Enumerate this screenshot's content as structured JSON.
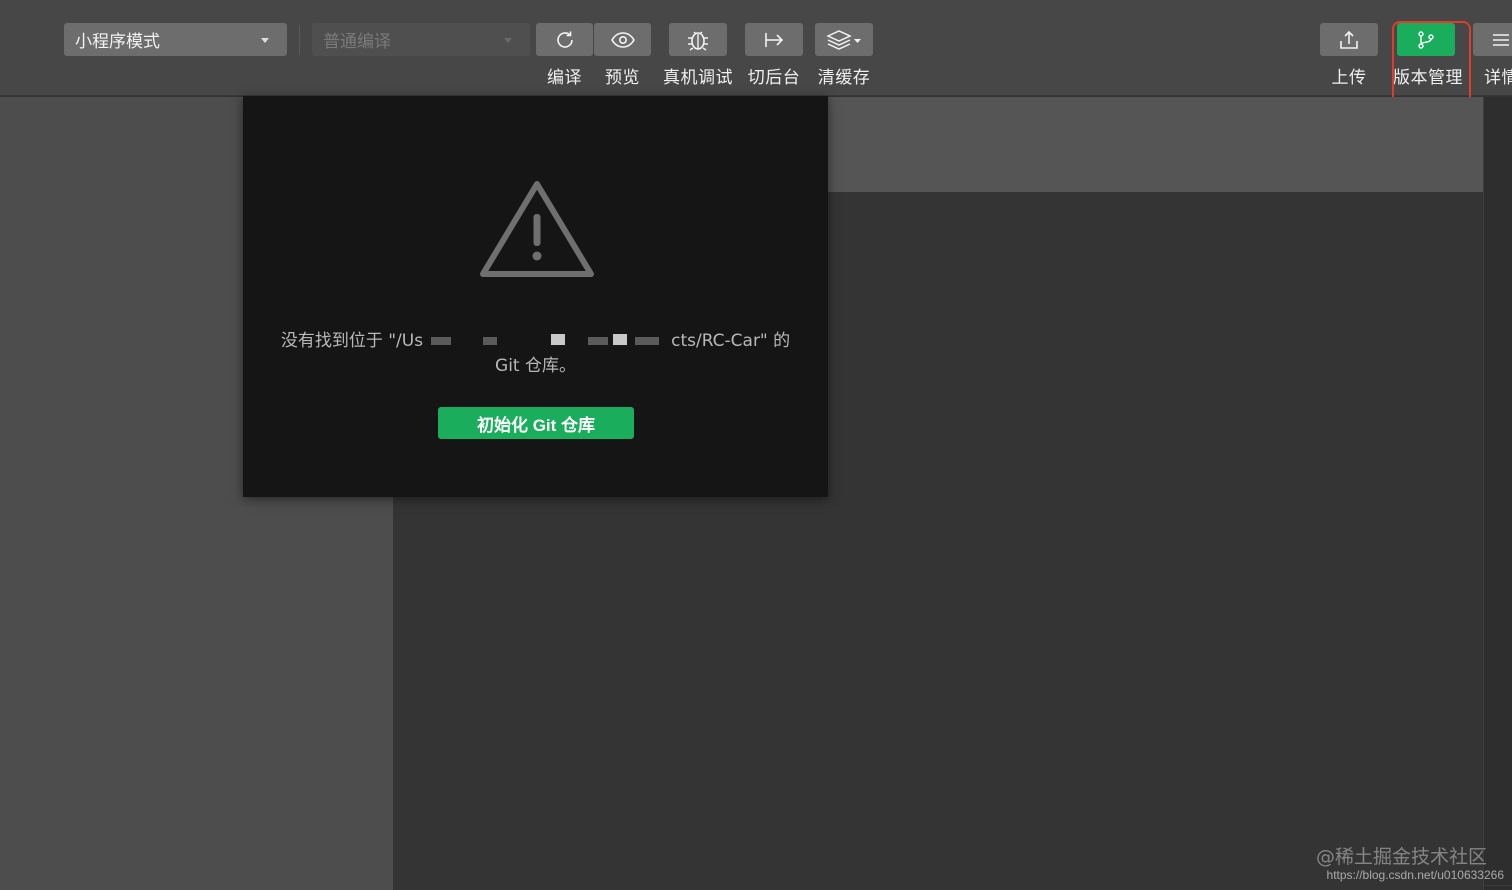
{
  "toolbar": {
    "mode_select": "小程序模式",
    "compile_select_placeholder": "普通编译",
    "buttons": [
      {
        "label": "编译",
        "icon": "refresh-icon"
      },
      {
        "label": "预览",
        "icon": "eye-icon"
      },
      {
        "label": "真机调试",
        "icon": "bug-icon"
      },
      {
        "label": "切后台",
        "icon": "switch-background-icon"
      },
      {
        "label": "清缓存",
        "icon": "layers-icon"
      },
      {
        "label": "上传",
        "icon": "upload-icon"
      },
      {
        "label": "版本管理",
        "icon": "git-branch-icon"
      },
      {
        "label": "详情",
        "icon": "menu-icon"
      }
    ]
  },
  "dialog": {
    "icon": "warning-icon",
    "message_prefix": "没有找到位于 \"/Us",
    "message_suffix": "cts/RC-Car\" 的",
    "message_line2": "Git 仓库。",
    "init_button": "初始化 Git 仓库"
  },
  "watermark": {
    "site": "@稀土掘金技术社区",
    "url": "https://blog.csdn.net/u010633266"
  },
  "colors": {
    "accent_green": "#1aad5c",
    "highlight_red": "#e53a2a",
    "toolbar_bg": "#474747",
    "dialog_bg": "#151515"
  }
}
